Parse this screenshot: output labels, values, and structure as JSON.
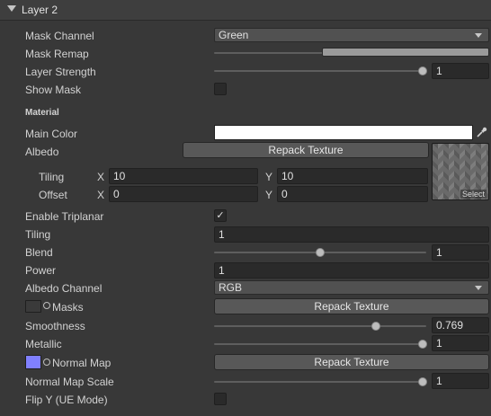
{
  "header": {
    "title": "Layer 2"
  },
  "mask_channel": {
    "label": "Mask Channel",
    "value": "Green"
  },
  "mask_remap": {
    "label": "Mask Remap",
    "min": 0.3,
    "max": 1.0
  },
  "layer_strength": {
    "label": "Layer Strength",
    "value": "1",
    "level": 1.0
  },
  "show_mask": {
    "label": "Show Mask",
    "checked": false
  },
  "material": {
    "section_label": "Material"
  },
  "main_color": {
    "label": "Main Color",
    "color": "#ffffff",
    "eyedropper_icon": "eyedropper-icon"
  },
  "albedo": {
    "label": "Albedo",
    "repack_label": "Repack Texture",
    "tiling_label": "Tiling",
    "offset_label": "Offset",
    "x_label": "X",
    "y_label": "Y",
    "tiling_x": "10",
    "tiling_y": "10",
    "offset_x": "0",
    "offset_y": "0",
    "select_label": "Select"
  },
  "triplanar": {
    "label": "Enable Triplanar",
    "check": "✓"
  },
  "tiling": {
    "label": "Tiling",
    "value": "1"
  },
  "blend": {
    "label": "Blend",
    "value": "1",
    "level": 0.5
  },
  "power": {
    "label": "Power",
    "value": "1"
  },
  "albedo_channel": {
    "label": "Albedo Channel",
    "value": "RGB"
  },
  "masks": {
    "label": "Masks",
    "repack_label": "Repack Texture"
  },
  "smoothness": {
    "label": "Smoothness",
    "value": "0.769",
    "level": 0.769
  },
  "metallic": {
    "label": "Metallic",
    "value": "1",
    "level": 1.0
  },
  "normal_map": {
    "label": "Normal Map",
    "repack_label": "Repack Texture",
    "swatch_color": "#8080ff"
  },
  "normal_scale": {
    "label": "Normal Map Scale",
    "value": "1",
    "level": 1.0
  },
  "flip_y": {
    "label": "Flip Y (UE Mode)",
    "checked": false
  },
  "colors": {
    "background": "#383838",
    "field": "#2a2a2a",
    "button": "#585858"
  }
}
